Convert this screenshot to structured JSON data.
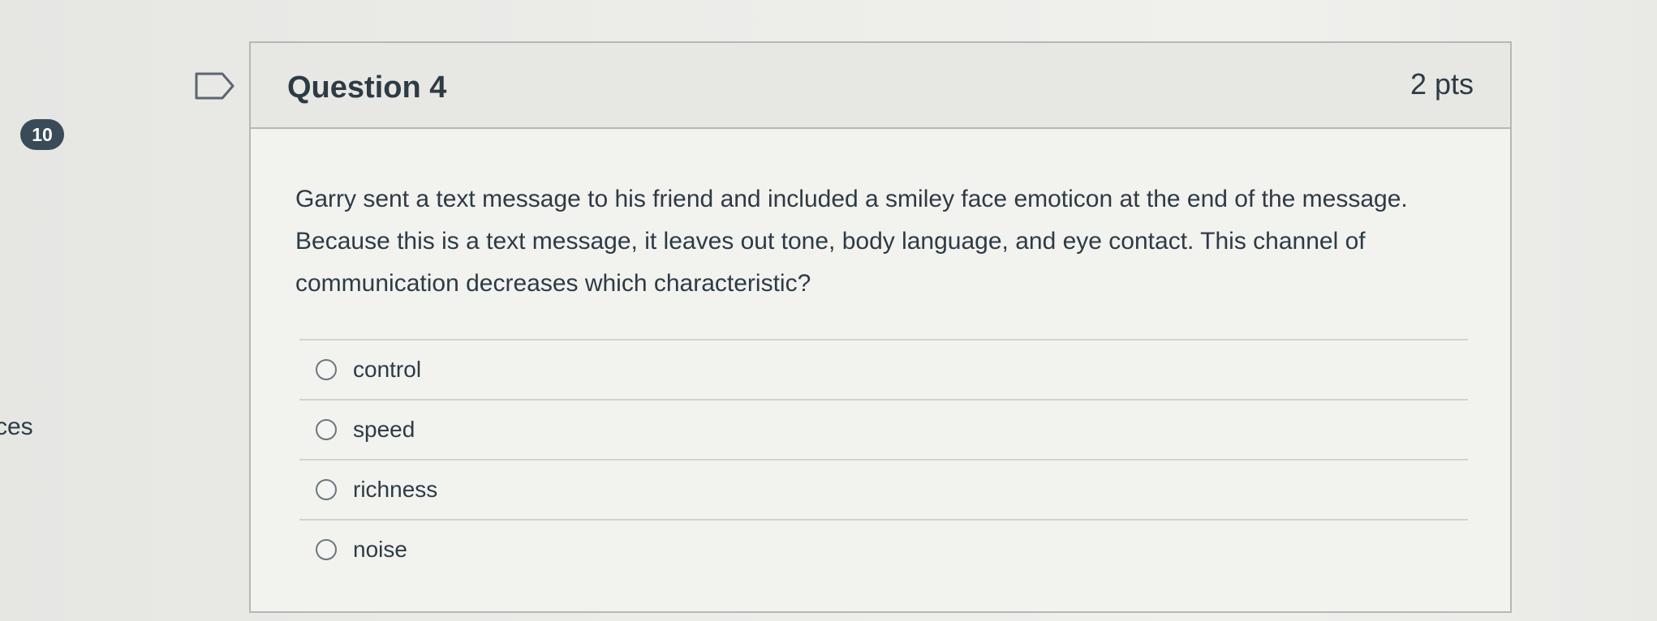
{
  "sidebar": {
    "badge": "10",
    "fragment": "ces"
  },
  "question": {
    "title": "Question 4",
    "points": "2 pts",
    "text": "Garry sent a text message to his friend and included a smiley face emoticon at the end of the message. Because this is a text message, it leaves out tone, body language, and eye contact. This channel of communication decreases which characteristic?",
    "answers": [
      {
        "label": "control"
      },
      {
        "label": "speed"
      },
      {
        "label": "richness"
      },
      {
        "label": "noise"
      }
    ]
  },
  "icons": {
    "flag": "flag-icon",
    "cursor": "mouse-cursor-icon"
  },
  "colors": {
    "badge_bg": "#394b58",
    "text": "#2d3b45",
    "border": "#b7b7b4"
  }
}
